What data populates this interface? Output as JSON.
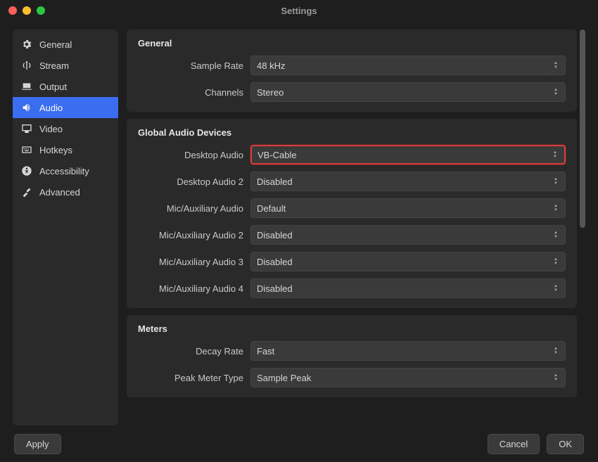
{
  "window": {
    "title": "Settings"
  },
  "sidebar": {
    "items": [
      {
        "label": "General"
      },
      {
        "label": "Stream"
      },
      {
        "label": "Output"
      },
      {
        "label": "Audio"
      },
      {
        "label": "Video"
      },
      {
        "label": "Hotkeys"
      },
      {
        "label": "Accessibility"
      },
      {
        "label": "Advanced"
      }
    ],
    "activeIndex": 3
  },
  "sections": {
    "general": {
      "heading": "General",
      "sample_rate_label": "Sample Rate",
      "sample_rate_value": "48 kHz",
      "channels_label": "Channels",
      "channels_value": "Stereo"
    },
    "devices": {
      "heading": "Global Audio Devices",
      "rows": [
        {
          "label": "Desktop Audio",
          "value": "VB-Cable",
          "highlighted": true
        },
        {
          "label": "Desktop Audio 2",
          "value": "Disabled"
        },
        {
          "label": "Mic/Auxiliary Audio",
          "value": "Default"
        },
        {
          "label": "Mic/Auxiliary Audio 2",
          "value": "Disabled"
        },
        {
          "label": "Mic/Auxiliary Audio 3",
          "value": "Disabled"
        },
        {
          "label": "Mic/Auxiliary Audio 4",
          "value": "Disabled"
        }
      ]
    },
    "meters": {
      "heading": "Meters",
      "decay_label": "Decay Rate",
      "decay_value": "Fast",
      "peak_label": "Peak Meter Type",
      "peak_value": "Sample Peak"
    }
  },
  "footer": {
    "apply": "Apply",
    "cancel": "Cancel",
    "ok": "OK"
  }
}
